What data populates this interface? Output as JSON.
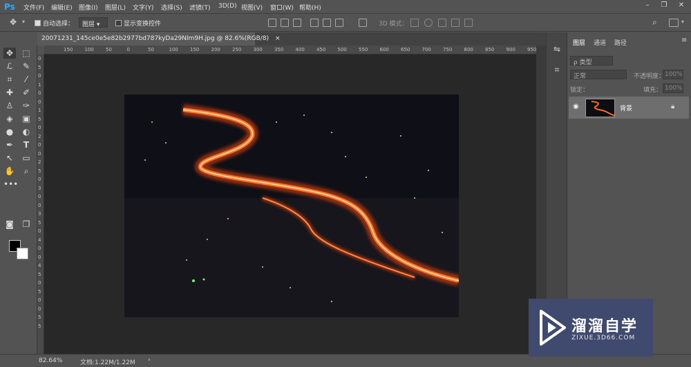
{
  "app": {
    "logo": "Ps"
  },
  "menu": [
    "文件(F)",
    "编辑(E)",
    "图像(I)",
    "图层(L)",
    "文字(Y)",
    "选择(S)",
    "滤镜(T)",
    "3D(D)",
    "视图(V)",
    "窗口(W)",
    "帮助(H)"
  ],
  "options": {
    "auto_select_label": "自动选择：",
    "auto_select_value": "图层",
    "show_transform_label": "显示变换控件",
    "mode_3d_label": "3D 模式："
  },
  "document": {
    "tab_title": "20071231_145ce0e5e82b2977bd787kyDa29NIm9H.jpg @ 82.6%(RGB/8)",
    "close": "×"
  },
  "ruler": {
    "h_ticks": [
      "150",
      "100",
      "50",
      "0",
      "50",
      "100",
      "150",
      "200",
      "250",
      "300",
      "350",
      "400",
      "450",
      "500",
      "550",
      "600",
      "650",
      "700",
      "750",
      "800",
      "850",
      "900",
      "950"
    ],
    "v_ticks": [
      "0",
      "5",
      "0",
      "1",
      "0",
      "0",
      "1",
      "5",
      "0",
      "2",
      "0",
      "0",
      "2",
      "5",
      "0",
      "3",
      "0",
      "0",
      "3",
      "5",
      "0",
      "4",
      "0",
      "0",
      "4",
      "5",
      "0",
      "5",
      "0",
      "0",
      "5",
      "5"
    ]
  },
  "layers_panel": {
    "tabs": [
      "图层",
      "通道",
      "路径"
    ],
    "filter_label": "ρ 类型",
    "blend_mode": "正常",
    "opacity_label": "不透明度：",
    "opacity_value": "100%",
    "lock_label": "锁定：",
    "fill_label": "填充：",
    "fill_value": "100%",
    "layer_name": "背景"
  },
  "status": {
    "zoom": "82.64%",
    "doc_info": "文档:1.22M/1.22M",
    "arrow": "›"
  },
  "watermark": {
    "title": "溜溜自学",
    "subtitle": "ZIXUE.3D66.COM"
  },
  "colors": {
    "accent_ps": "#31a8ff",
    "panel_bg": "#535353",
    "canvas_bg": "#282828",
    "road_light": "#ff5a14"
  }
}
